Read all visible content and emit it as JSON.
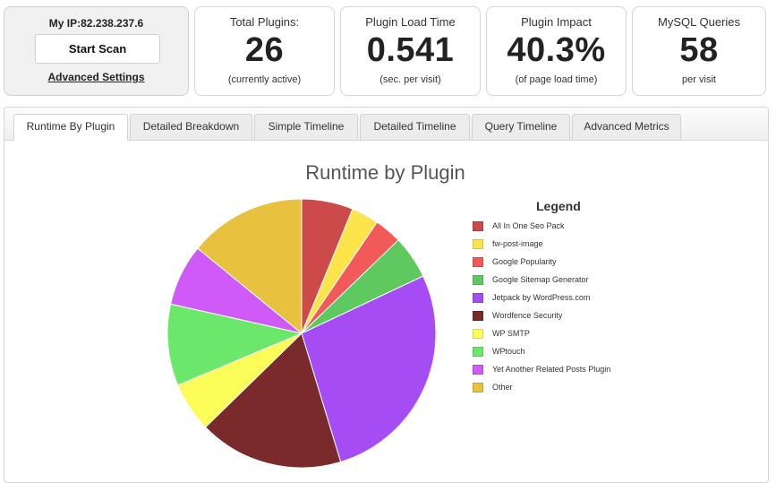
{
  "ip_box": {
    "ip_text": "My IP:82.238.237.6",
    "scan_button": "Start Scan",
    "advanced_link": "Advanced Settings"
  },
  "stats": [
    {
      "title": "Total Plugins:",
      "value": "26",
      "subtitle": "(currently active)"
    },
    {
      "title": "Plugin Load Time",
      "value": "0.541",
      "subtitle": "(sec. per visit)"
    },
    {
      "title": "Plugin Impact",
      "value": "40.3%",
      "subtitle": "(of page load time)"
    },
    {
      "title": "MySQL Queries",
      "value": "58",
      "subtitle": "per visit"
    }
  ],
  "tabs": [
    {
      "label": "Runtime By Plugin",
      "active": true
    },
    {
      "label": "Detailed Breakdown",
      "active": false
    },
    {
      "label": "Simple Timeline",
      "active": false
    },
    {
      "label": "Detailed Timeline",
      "active": false
    },
    {
      "label": "Query Timeline",
      "active": false
    },
    {
      "label": "Advanced Metrics",
      "active": false
    }
  ],
  "chart_data": {
    "type": "pie",
    "title": "Runtime by Plugin",
    "legend_title": "Legend",
    "legend_position": "right",
    "slices": [
      {
        "label": "All In One Seo Pack",
        "value": 6.2,
        "color": "#cc4a4a"
      },
      {
        "label": "fw-post-image",
        "value": 3.3,
        "color": "#fbe54b"
      },
      {
        "label": "Google Popularity",
        "value": 3.3,
        "color": "#f25a5a"
      },
      {
        "label": "Google Sitemap Generator",
        "value": 5.2,
        "color": "#5ec95e"
      },
      {
        "label": "Jetpack by WordPress.com",
        "value": 27.3,
        "color": "#a64cf5"
      },
      {
        "label": "Wordfence Security",
        "value": 17.4,
        "color": "#7a2a2a"
      },
      {
        "label": "WP SMTP",
        "value": 6.0,
        "color": "#fdfd5a"
      },
      {
        "label": "WPtouch",
        "value": 9.8,
        "color": "#6be86b"
      },
      {
        "label": "Yet Another Related Posts Plugin",
        "value": 7.4,
        "color": "#cf5af7"
      },
      {
        "label": "Other",
        "value": 14.1,
        "color": "#e8c23f"
      }
    ]
  }
}
